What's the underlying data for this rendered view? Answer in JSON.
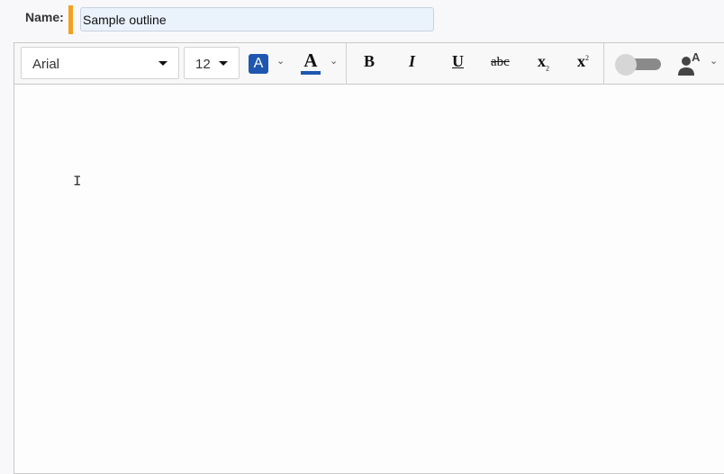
{
  "name": {
    "label": "Name:",
    "value": "Sample outline"
  },
  "toolbar": {
    "font_family": "Arial",
    "font_size": "12",
    "highlight_letter": "A",
    "highlight_color": "#1f57b0",
    "font_color_letter": "A",
    "font_color_bar": "#1f57b0",
    "bold": "B",
    "italic": "I",
    "underline": "U",
    "strikethrough": "abc",
    "subscript": "x",
    "subscript_mark": "2",
    "superscript": "x",
    "superscript_mark": "2",
    "toggle_on": false,
    "person_letter": "A",
    "chevron": "⌄"
  },
  "accent_color": "#f4a020"
}
